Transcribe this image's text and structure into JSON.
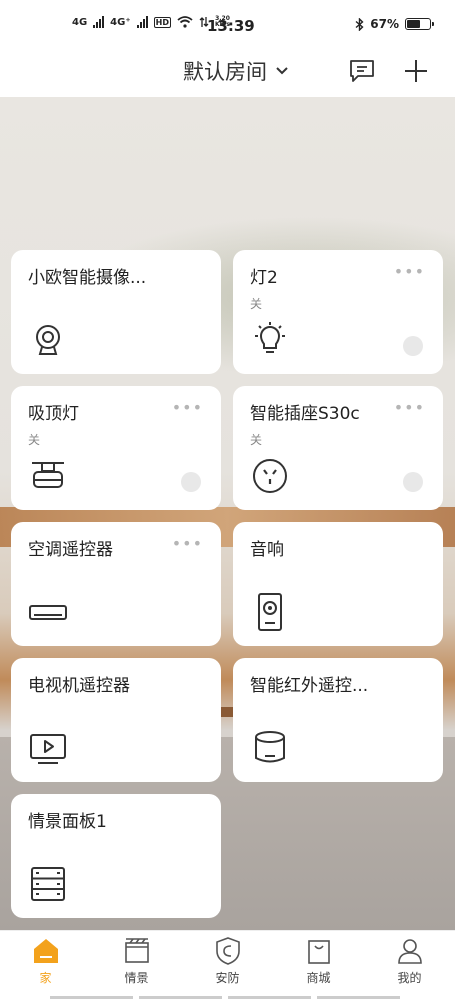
{
  "status_bar": {
    "net1": "4G",
    "net2": "4G⁺",
    "hd": "HD",
    "speed_value": "3.20",
    "speed_unit": "KB/s",
    "time": "13:39",
    "battery": "67%",
    "battery_level": 0.67
  },
  "header": {
    "room_name": "默认房间",
    "icons": [
      "chevron-down-icon",
      "message-icon",
      "plus-icon"
    ]
  },
  "devices": [
    {
      "name": "小欧智能摄像...",
      "status": "",
      "has_more": false,
      "has_toggle": false,
      "icon": "camera-icon"
    },
    {
      "name": "灯2",
      "status": "关",
      "has_more": true,
      "has_toggle": true,
      "icon": "bulb-icon"
    },
    {
      "name": "吸顶灯",
      "status": "关",
      "has_more": true,
      "has_toggle": true,
      "icon": "ceiling-light-icon"
    },
    {
      "name": "智能插座S30c",
      "status": "关",
      "has_more": true,
      "has_toggle": true,
      "icon": "socket-icon"
    },
    {
      "name": "空调遥控器",
      "status": "",
      "has_more": true,
      "has_toggle": false,
      "icon": "air-conditioner-icon"
    },
    {
      "name": "音响",
      "status": "",
      "has_more": false,
      "has_toggle": false,
      "icon": "speaker-icon"
    },
    {
      "name": "电视机遥控器",
      "status": "",
      "has_more": false,
      "has_toggle": false,
      "icon": "tv-icon"
    },
    {
      "name": "智能红外遥控...",
      "status": "",
      "has_more": false,
      "has_toggle": false,
      "icon": "ir-remote-icon"
    },
    {
      "name": "情景面板1",
      "status": "",
      "has_more": false,
      "has_toggle": false,
      "icon": "scene-panel-icon"
    }
  ],
  "more_symbol": "•••",
  "nav": [
    {
      "label": "家",
      "icon": "home-icon",
      "active": true
    },
    {
      "label": "情景",
      "icon": "scene-icon",
      "active": false
    },
    {
      "label": "安防",
      "icon": "security-icon",
      "active": false
    },
    {
      "label": "商城",
      "icon": "shop-icon",
      "active": false
    },
    {
      "label": "我的",
      "icon": "profile-icon",
      "active": false
    }
  ],
  "colors": {
    "accent": "#f3a21c",
    "card": "#ffffff",
    "toggle_off": "#e8e8e8"
  }
}
